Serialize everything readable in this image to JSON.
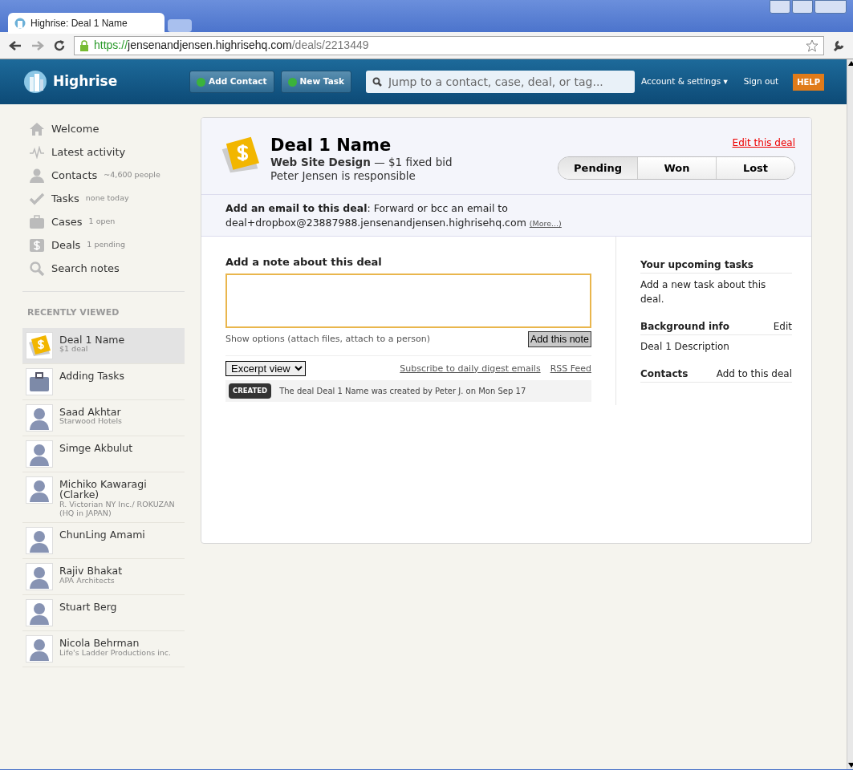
{
  "browser": {
    "tab_title": "Highrise: Deal 1 Name",
    "url": {
      "scheme": "https://",
      "host": "jensenandjensen.highrisehq.com",
      "path": "/deals/2213449"
    }
  },
  "header": {
    "logo": "Highrise",
    "buttons": [
      "Add Contact",
      "New Task"
    ],
    "search": {
      "placeholder": "Jump to a contact, case, deal, or tag..."
    },
    "account": "Account & settings ▾",
    "sign_out": "Sign out",
    "help": "HELP"
  },
  "sidebar": {
    "nav": [
      {
        "kind": "home",
        "label": "Welcome"
      },
      {
        "kind": "activity",
        "label": "Latest activity"
      },
      {
        "kind": "person",
        "label": "Contacts",
        "count": "~4,600 people"
      },
      {
        "kind": "check",
        "label": "Tasks",
        "count": "none today"
      },
      {
        "kind": "case",
        "label": "Cases",
        "count": "1 open"
      },
      {
        "kind": "deal",
        "label": "Deals",
        "count": "1 pending"
      },
      {
        "kind": "search",
        "label": "Search notes"
      }
    ],
    "recent_title": "RECENTLY VIEWED",
    "recent": [
      {
        "kind": "deal",
        "name": "Deal 1 Name",
        "sub": "$1 deal",
        "selected": true
      },
      {
        "kind": "case",
        "name": "Adding Tasks",
        "selected": false
      },
      {
        "kind": "person",
        "name": "Saad Akhtar",
        "sub": "Starwood Hotels",
        "selected": false
      },
      {
        "kind": "person",
        "name": "Simge Akbulut",
        "selected": false
      },
      {
        "kind": "person",
        "name": "Michiko Kawaragi (Clarke)",
        "sub": "R. Victorian NY Inc./ ROKUZAN (HQ in JAPAN)",
        "selected": false
      },
      {
        "kind": "person",
        "name": "ChunLing Amami",
        "selected": false
      },
      {
        "kind": "person",
        "name": "Rajiv Bhakat",
        "sub": "APA Architects",
        "selected": false
      },
      {
        "kind": "person",
        "name": "Stuart Berg",
        "selected": false
      },
      {
        "kind": "person",
        "name": "Nicola Behrman",
        "sub": "Life's Ladder Productions inc.",
        "selected": false
      }
    ]
  },
  "deal": {
    "title": "Deal 1 Name",
    "category": "Web Site Design",
    "price": " — $1 fixed bid",
    "responsible": "Peter Jensen is responsible",
    "edit_link": "Edit this deal",
    "status": [
      {
        "label": "Pending",
        "selected": true
      },
      {
        "label": "Won",
        "selected": false
      },
      {
        "label": "Lost",
        "selected": false
      }
    ],
    "email": {
      "text": "**Add an email to this deal**: Forward or bcc an email to",
      "address": "deal+dropbox@23887988.jensenandjensen.highrisehq.com",
      "more": "(More...)"
    }
  },
  "note": {
    "title": "Add a note about this deal",
    "show_options": "Show options",
    "options_hint": " (attach files, attach to a person)",
    "submit": "Add this note"
  },
  "feed": {
    "view": "Excerpt view",
    "subscribe": "Subscribe to daily digest emails",
    "rss": "RSS Feed",
    "items": [
      {
        "badge": "CREATED",
        "text": "The deal Deal 1 Name was created by Peter J. on Mon Sep 17"
      }
    ]
  },
  "side": {
    "tasks_title": "Your upcoming tasks",
    "add_task": "Add a new task",
    "add_task_rest": " about this deal.",
    "background_title": "Background info",
    "background_edit": "Edit",
    "background_text": "Deal 1 Description",
    "contacts_title": "Contacts",
    "contacts_add": "Add to this deal"
  }
}
